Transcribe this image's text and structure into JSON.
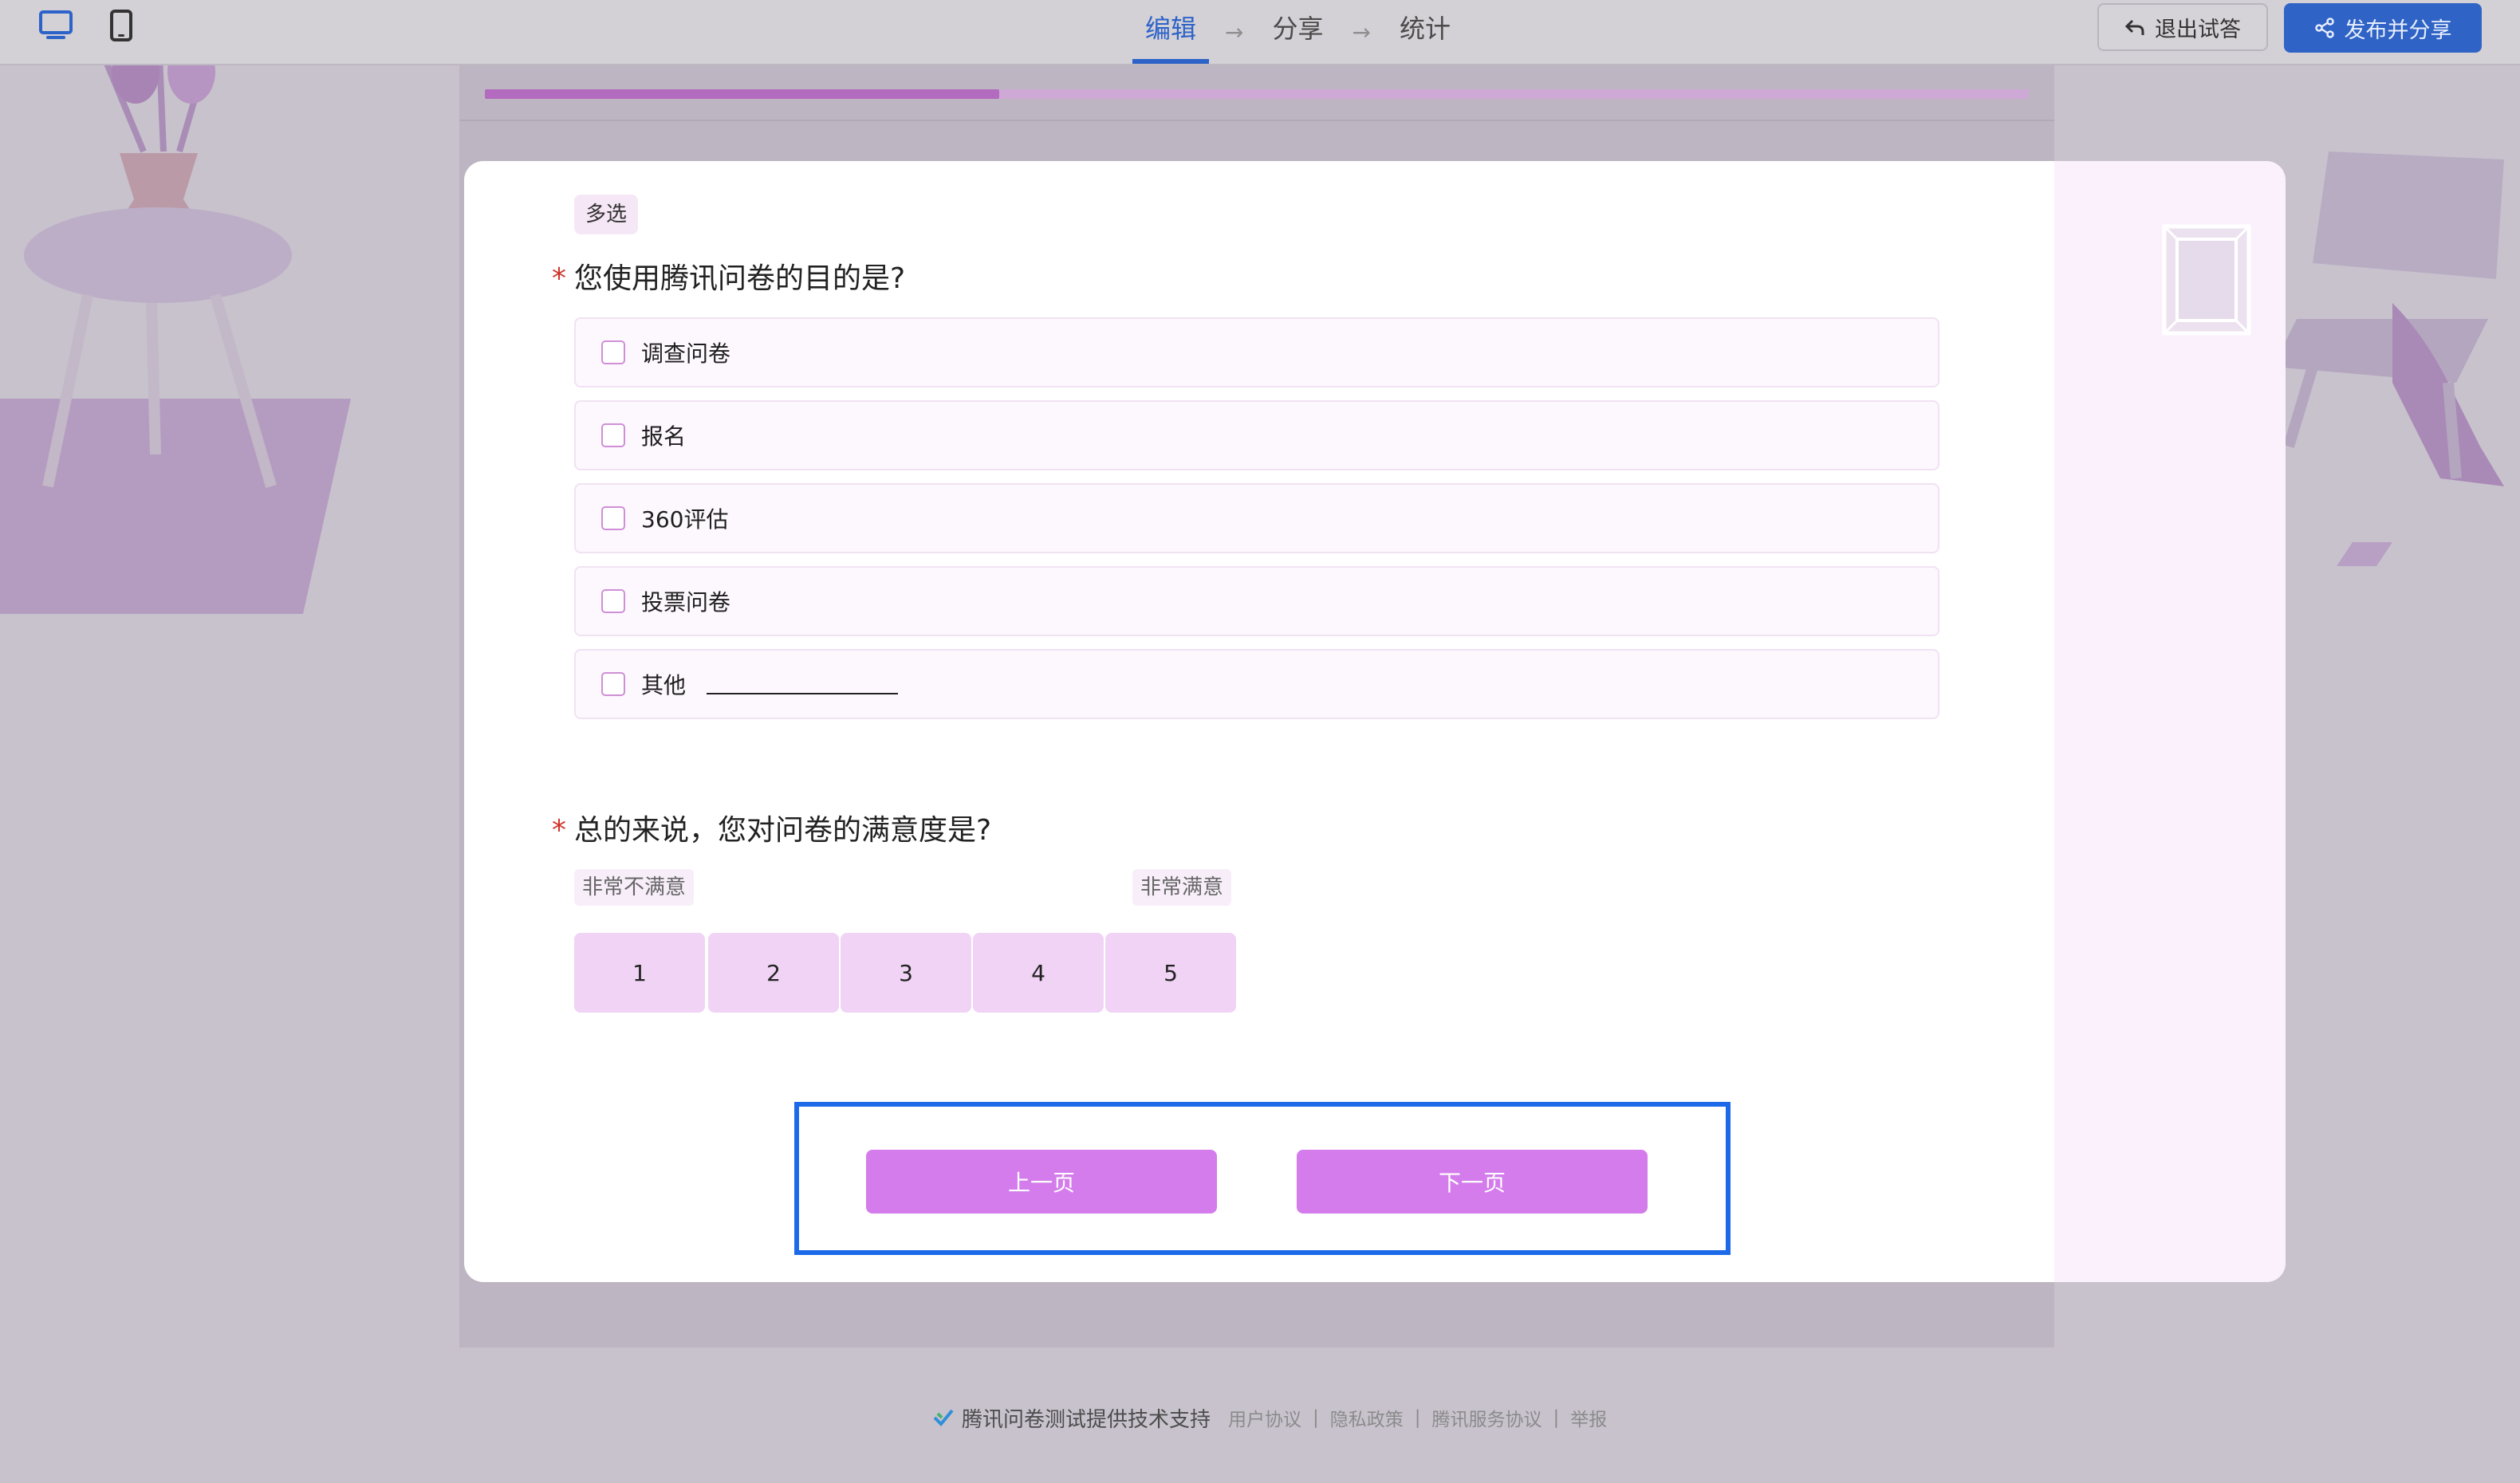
{
  "topbar": {
    "steps": [
      "编辑",
      "分享",
      "统计"
    ],
    "exit_label": "退出试答",
    "publish_label": "发布并分享"
  },
  "progress": {
    "fraction": 0.333
  },
  "question1": {
    "type_badge": "多选",
    "required_mark": "*",
    "title": "您使用腾讯问卷的目的是?",
    "options": [
      "调查问卷",
      "报名",
      "360评估",
      "投票问卷",
      "其他"
    ]
  },
  "question2": {
    "required_mark": "*",
    "title": "总的来说，您对问卷的满意度是?",
    "min_label": "非常不满意",
    "max_label": "非常满意",
    "scale": [
      "1",
      "2",
      "3",
      "4",
      "5"
    ]
  },
  "nav": {
    "prev_label": "上一页",
    "next_label": "下一页"
  },
  "footer": {
    "brand": "腾讯问卷测试提供技术支持",
    "links": [
      "用户协议",
      "隐私政策",
      "腾讯服务协议",
      "举报"
    ],
    "separator": "|"
  },
  "colors": {
    "accent": "#2f63c6",
    "option_button": "#d47cec",
    "scale_button": "#f0d3f5",
    "required": "#d0352a",
    "highlight": "#1c6ae8"
  }
}
